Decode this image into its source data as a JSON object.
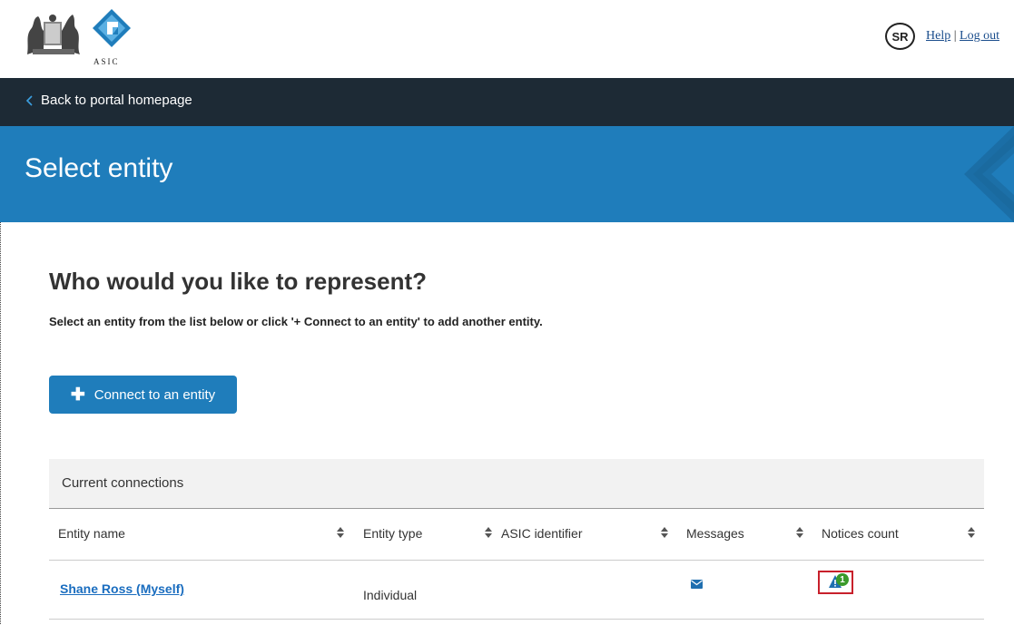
{
  "header": {
    "logo_text": "ASIC",
    "user_initials": "SR",
    "help_label": "Help",
    "separator": "|",
    "logout_label": "Log out"
  },
  "nav": {
    "back_label": "Back to portal homepage"
  },
  "banner": {
    "title": "Select entity"
  },
  "main": {
    "question": "Who would you like to represent?",
    "instruction": "Select an entity from the list below or click '+ Connect to an entity' to add another entity.",
    "connect_button_label": "Connect to an entity",
    "connect_button_icon": "plus-icon"
  },
  "table": {
    "caption": "Current connections",
    "columns": [
      "Entity name",
      "Entity type",
      "ASIC identifier",
      "Messages",
      "Notices count"
    ],
    "rows": [
      {
        "entity_name": "Shane Ross (Myself)",
        "entity_type": "Individual",
        "asic_identifier": "",
        "messages_icon": "envelope-icon",
        "notices_count": "1",
        "notices_icon": "warning-icon"
      }
    ]
  },
  "colors": {
    "nav_bg": "#1d2a35",
    "banner_bg": "#1f7dbb",
    "button_bg": "#1f7dbb",
    "link": "#1a6dbf",
    "badge_green": "#3a9a2a",
    "highlight_red": "#c8202b"
  }
}
